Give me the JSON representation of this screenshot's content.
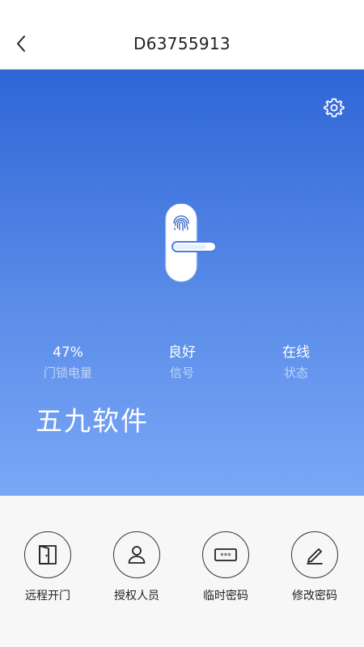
{
  "header": {
    "title": "D63755913",
    "back_icon": "chevron-left-icon"
  },
  "hero": {
    "settings_icon": "gear-icon",
    "lock_icon": "smart-lock-fingerprint-icon",
    "stats": [
      {
        "value": "47%",
        "label": "门锁电量"
      },
      {
        "value": "良好",
        "label": "信号"
      },
      {
        "value": "在线",
        "label": "状态"
      }
    ],
    "watermark": "五九软件"
  },
  "actions": [
    {
      "label": "远程开门",
      "icon": "door-icon"
    },
    {
      "label": "授权人员",
      "icon": "person-icon"
    },
    {
      "label": "临时密码",
      "icon": "password-icon"
    },
    {
      "label": "修改密码",
      "icon": "pen-icon"
    }
  ],
  "colors": {
    "hero_top": "#2f66d6",
    "hero_bottom": "#7aa7f7",
    "text_dark": "#222222",
    "action_bg": "#f7f7f7"
  }
}
